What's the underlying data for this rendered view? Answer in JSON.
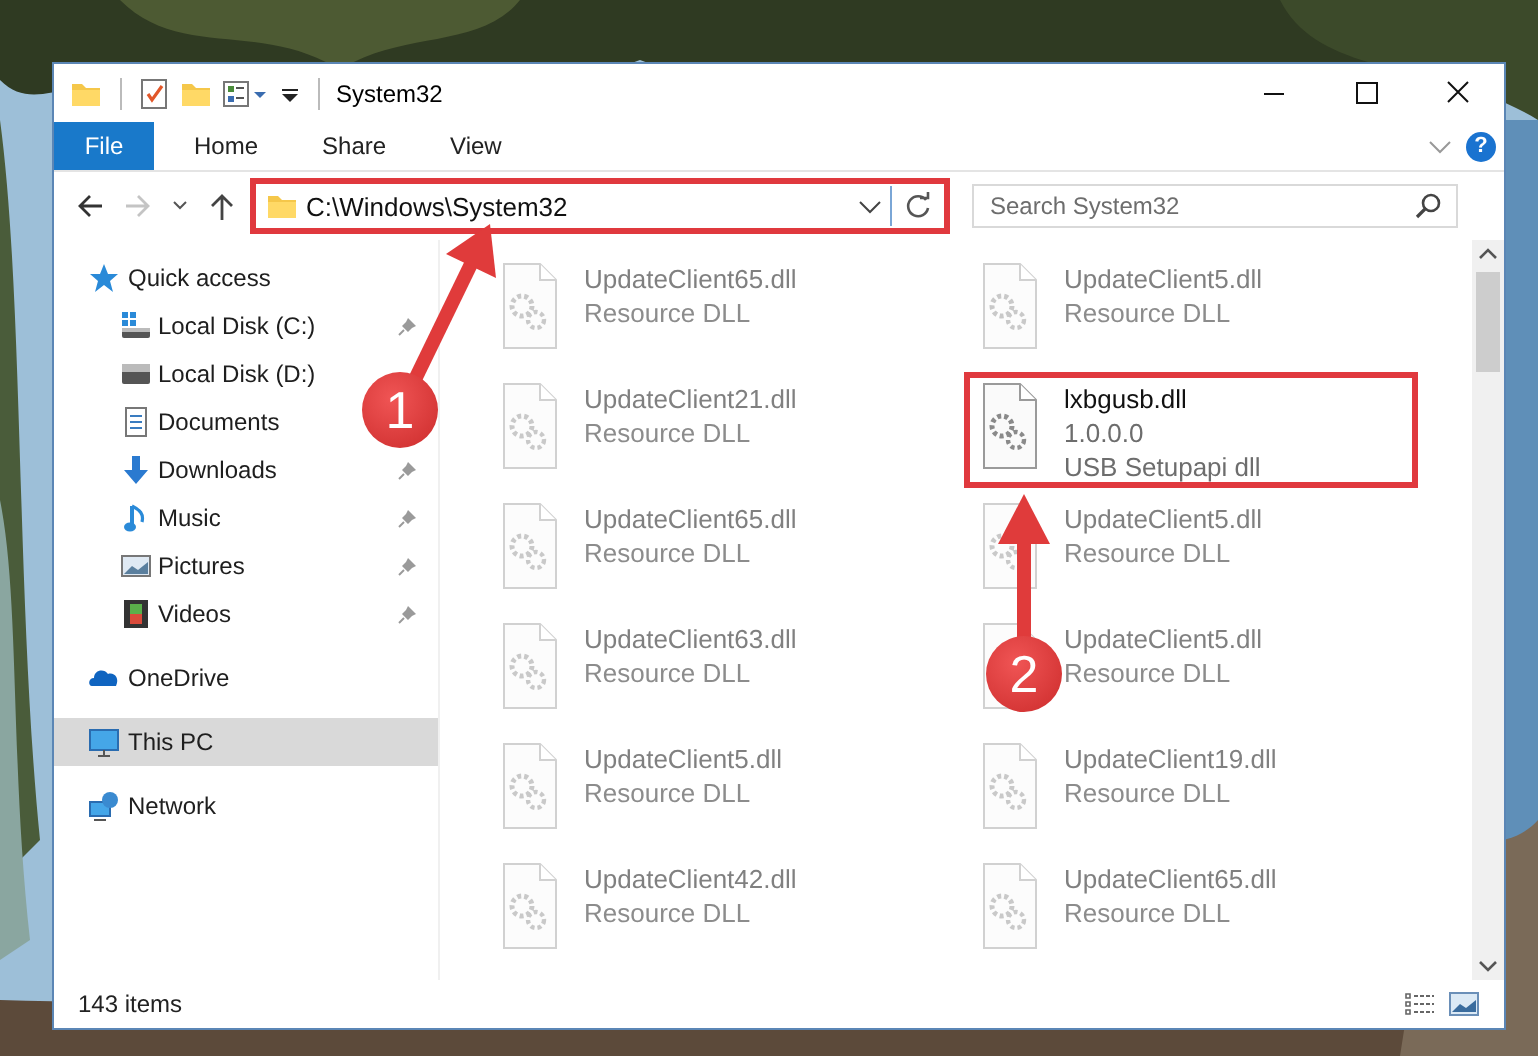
{
  "window": {
    "title": "System32"
  },
  "ribbon_tabs": [
    {
      "label": "File",
      "kind": "file",
      "selected": false
    },
    {
      "label": "Home",
      "kind": "tab",
      "selected": false
    },
    {
      "label": "Share",
      "kind": "tab",
      "selected": false
    },
    {
      "label": "View",
      "kind": "tab",
      "selected": false
    }
  ],
  "help": "?",
  "address_bar": {
    "value": "C:\\Windows\\System32",
    "highlighted": true
  },
  "search": {
    "placeholder": "Search System32"
  },
  "sidebar": {
    "items": [
      {
        "label": "Quick access",
        "selected": false,
        "children": [
          {
            "label": "Local Disk (C:)",
            "selected": false,
            "pinned": true
          },
          {
            "label": "Local Disk (D:)",
            "selected": false
          },
          {
            "label": "Documents",
            "selected": false
          },
          {
            "label": "Downloads",
            "selected": false,
            "pinned": true
          },
          {
            "label": "Music",
            "selected": false,
            "pinned": true
          },
          {
            "label": "Pictures",
            "selected": false,
            "pinned": true
          },
          {
            "label": "Videos",
            "selected": false,
            "pinned": true
          }
        ]
      },
      {
        "label": "OneDrive",
        "selected": false
      },
      {
        "label": "This PC",
        "selected": true
      },
      {
        "label": "Network",
        "selected": false
      }
    ]
  },
  "files": [
    {
      "name": "UpdateClient65.dll",
      "details": [
        "Resource DLL"
      ],
      "blurred": true,
      "highlighted": false
    },
    {
      "name": "UpdateClient5.dll",
      "details": [
        "Resource DLL"
      ],
      "blurred": true,
      "highlighted": false
    },
    {
      "name": "UpdateClient21.dll",
      "details": [
        "Resource DLL"
      ],
      "blurred": true,
      "highlighted": false
    },
    {
      "name": "lxbgusb.dll",
      "details": [
        "1.0.0.0",
        "USB Setupapi dll"
      ],
      "blurred": false,
      "highlighted": true
    },
    {
      "name": "UpdateClient65.dll",
      "details": [
        "Resource DLL"
      ],
      "blurred": true,
      "highlighted": false
    },
    {
      "name": "UpdateClient5.dll",
      "details": [
        "Resource DLL"
      ],
      "blurred": true,
      "highlighted": false
    },
    {
      "name": "UpdateClient63.dll",
      "details": [
        "Resource DLL"
      ],
      "blurred": true,
      "highlighted": false
    },
    {
      "name": "UpdateClient5.dll",
      "details": [
        "Resource DLL"
      ],
      "blurred": true,
      "highlighted": false
    },
    {
      "name": "UpdateClient5.dll",
      "details": [
        "Resource DLL"
      ],
      "blurred": true,
      "highlighted": false
    },
    {
      "name": "UpdateClient19.dll",
      "details": [
        "Resource DLL"
      ],
      "blurred": true,
      "highlighted": false
    },
    {
      "name": "UpdateClient42.dll",
      "details": [
        "Resource DLL"
      ],
      "blurred": true,
      "highlighted": false
    },
    {
      "name": "UpdateClient65.dll",
      "details": [
        "Resource DLL"
      ],
      "blurred": true,
      "highlighted": false
    }
  ],
  "status_bar": {
    "item_count": "143 items"
  },
  "annotations": [
    {
      "label": "1"
    },
    {
      "label": "2"
    }
  ]
}
